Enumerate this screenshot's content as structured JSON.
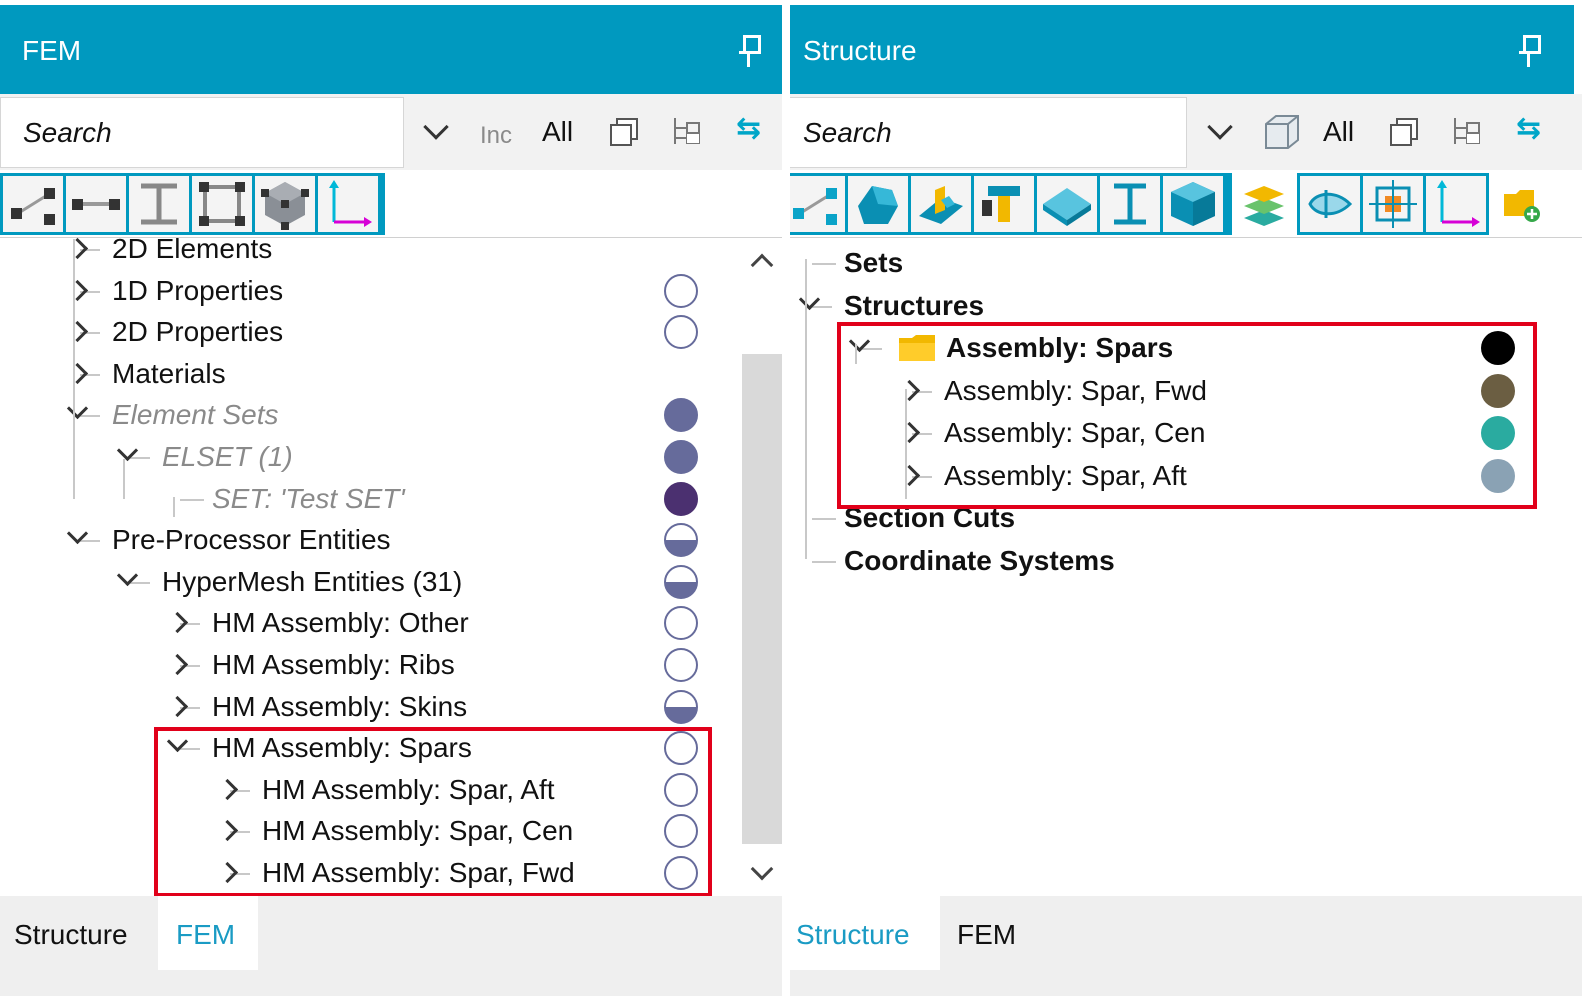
{
  "fem": {
    "title": "FEM",
    "search_placeholder": "Search",
    "inc_label": "Inc",
    "all_label": "All",
    "tree": [
      {
        "label": "2D Elements",
        "style": "normal",
        "depth": 0,
        "expander": "collapsed",
        "status": "none"
      },
      {
        "label": "1D Properties",
        "style": "normal",
        "depth": 0,
        "expander": "collapsed",
        "status": "empty"
      },
      {
        "label": "2D Properties",
        "style": "normal",
        "depth": 0,
        "expander": "collapsed",
        "status": "empty"
      },
      {
        "label": "Materials",
        "style": "normal",
        "depth": 0,
        "expander": "collapsed",
        "status": "none"
      },
      {
        "label": "Element Sets",
        "style": "italic",
        "depth": 0,
        "expander": "expanded",
        "status": "full"
      },
      {
        "label": "ELSET (1)",
        "style": "italic",
        "depth": 1,
        "expander": "expanded",
        "status": "full"
      },
      {
        "label": "SET: 'Test SET'",
        "style": "italic",
        "depth": 2,
        "expander": "none",
        "status": "dark"
      },
      {
        "label": "Pre-Processor Entities",
        "style": "normal",
        "depth": 0,
        "expander": "expanded",
        "status": "half"
      },
      {
        "label": "HyperMesh Entities (31)",
        "style": "normal",
        "depth": 1,
        "expander": "expanded",
        "status": "half"
      },
      {
        "label": "HM Assembly: Other",
        "style": "normal",
        "depth": 2,
        "expander": "collapsed",
        "status": "empty"
      },
      {
        "label": "HM Assembly: Ribs",
        "style": "normal",
        "depth": 2,
        "expander": "collapsed",
        "status": "empty"
      },
      {
        "label": "HM Assembly: Skins",
        "style": "normal",
        "depth": 2,
        "expander": "collapsed",
        "status": "half"
      },
      {
        "label": "HM Assembly: Spars",
        "style": "normal",
        "depth": 2,
        "expander": "expanded",
        "status": "empty"
      },
      {
        "label": "HM Assembly: Spar, Aft",
        "style": "normal",
        "depth": 3,
        "expander": "collapsed",
        "status": "empty"
      },
      {
        "label": "HM Assembly: Spar, Cen",
        "style": "normal",
        "depth": 3,
        "expander": "collapsed",
        "status": "empty"
      },
      {
        "label": "HM Assembly: Spar, Fwd",
        "style": "normal",
        "depth": 3,
        "expander": "collapsed",
        "status": "empty"
      }
    ],
    "tabs": [
      {
        "label": "Structure",
        "active": false
      },
      {
        "label": "FEM",
        "active": true
      }
    ]
  },
  "structure": {
    "title": "Structure",
    "search_placeholder": "Search",
    "all_label": "All",
    "tree": [
      {
        "label": "Sets",
        "style": "bold",
        "depth": 0,
        "expander": "none",
        "color": ""
      },
      {
        "label": "Structures",
        "style": "bold",
        "depth": 0,
        "expander": "expanded",
        "color": ""
      },
      {
        "label": "Assembly: Spars",
        "style": "bold",
        "depth": 1,
        "expander": "expanded",
        "color": "#000000",
        "folder": true
      },
      {
        "label": "Assembly: Spar, Fwd",
        "style": "normal",
        "depth": 2,
        "expander": "collapsed",
        "color": "#6b5e42"
      },
      {
        "label": "Assembly: Spar, Cen",
        "style": "normal",
        "depth": 2,
        "expander": "collapsed",
        "color": "#2aaba0"
      },
      {
        "label": "Assembly: Spar, Aft",
        "style": "normal",
        "depth": 2,
        "expander": "collapsed",
        "color": "#8aa2b4"
      },
      {
        "label": "Section Cuts",
        "style": "bold",
        "depth": 0,
        "expander": "none",
        "color": ""
      },
      {
        "label": "Coordinate Systems",
        "style": "bold",
        "depth": 0,
        "expander": "none",
        "color": ""
      }
    ],
    "tabs": [
      {
        "label": "Structure",
        "active": true
      },
      {
        "label": "FEM",
        "active": false
      }
    ]
  },
  "colors": {
    "header": "#0099bf",
    "highlight": "#e1001a",
    "status_fill": "#666b9b",
    "status_dark": "#4b3070",
    "active_tab": "#1a9bc4"
  }
}
